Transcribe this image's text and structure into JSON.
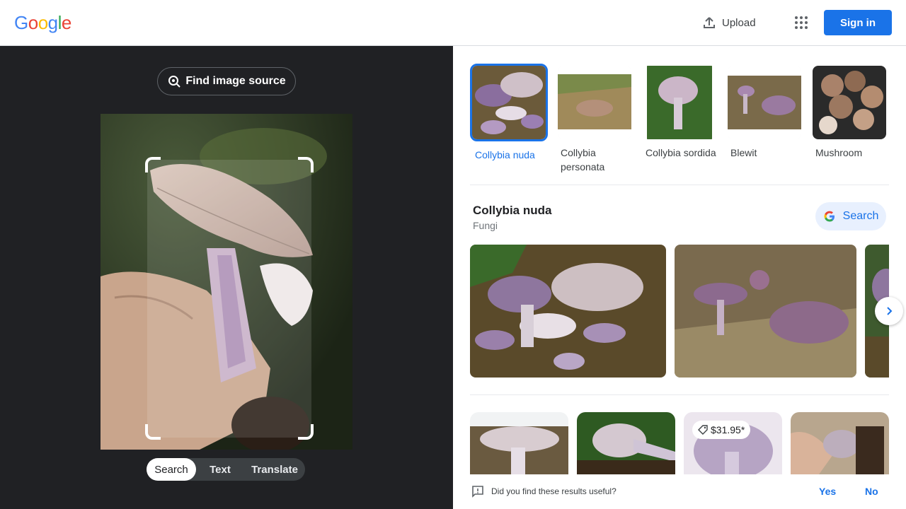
{
  "header": {
    "logo_letters": [
      "G",
      "o",
      "o",
      "g",
      "l",
      "e"
    ],
    "logo_colors": [
      "#4285f4",
      "#ea4335",
      "#fbbc05",
      "#4285f4",
      "#34a853",
      "#ea4335"
    ],
    "upload_label": "Upload",
    "signin_label": "Sign in"
  },
  "left_panel": {
    "find_source_label": "Find image source",
    "modes": [
      {
        "label": "Search",
        "active": true
      },
      {
        "label": "Text",
        "active": false
      },
      {
        "label": "Translate",
        "active": false
      }
    ]
  },
  "matches": [
    {
      "label": "Collybia nuda",
      "selected": true
    },
    {
      "label": "Collybia personata",
      "selected": false
    },
    {
      "label": "Collybia sordida",
      "selected": false
    },
    {
      "label": "Blewit",
      "selected": false
    },
    {
      "label": "Mushroom",
      "selected": false
    }
  ],
  "entity": {
    "title": "Collybia nuda",
    "subtitle": "Fungi",
    "search_label": "Search"
  },
  "results": {
    "price_tag": "$31.95*"
  },
  "feedback": {
    "question": "Did you find these results useful?",
    "yes_label": "Yes",
    "no_label": "No"
  },
  "colors": {
    "accent": "#1a73e8",
    "left_bg": "#202124"
  }
}
